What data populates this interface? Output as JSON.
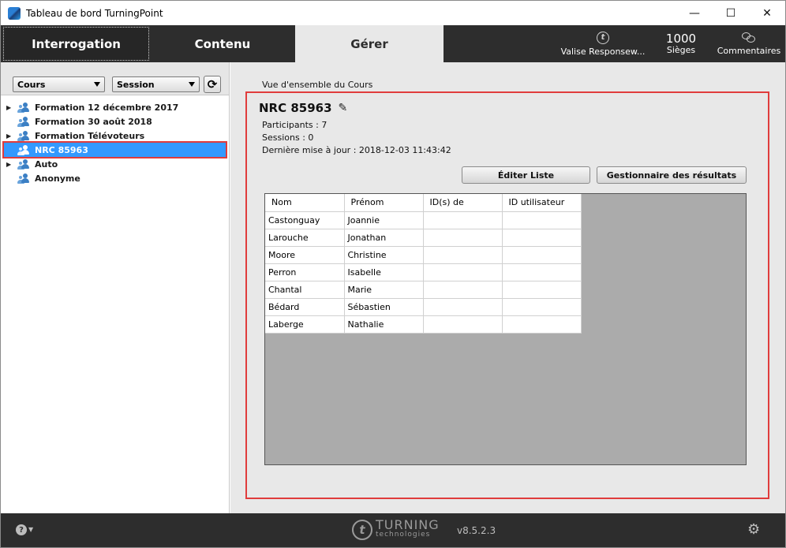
{
  "window": {
    "title": "Tableau de bord TurningPoint",
    "controls": {
      "minimize": "—",
      "maximize": "☐",
      "close": "✕"
    }
  },
  "topnav": {
    "tabs": [
      {
        "label": "Interrogation"
      },
      {
        "label": "Contenu"
      },
      {
        "label": "Gérer"
      }
    ],
    "active_tab": "Gérer",
    "valise": {
      "icon": "turning-t-icon",
      "label": "Valise Responsew..."
    },
    "sieges": {
      "count": "1000",
      "label": "Sièges"
    },
    "commentaires": {
      "icon": "comments-icon",
      "label": "Commentaires"
    }
  },
  "left": {
    "course_dropdown": "Cours",
    "session_dropdown": "Session",
    "refresh_icon": "refresh-icon",
    "tree": [
      {
        "label": "Formation 12 décembre 2017",
        "expandable": true
      },
      {
        "label": "Formation 30 août 2018",
        "expandable": false
      },
      {
        "label": "Formation Télévoteurs",
        "expandable": true
      },
      {
        "label": "NRC 85963",
        "expandable": false,
        "selected": true
      },
      {
        "label": "Auto",
        "expandable": true
      },
      {
        "label": "Anonyme",
        "expandable": false
      }
    ]
  },
  "main": {
    "section_label": "Vue d'ensemble du Cours",
    "course_title": "NRC 85963",
    "participants": "Participants : 7",
    "sessions": "Sessions : 0",
    "last_update": "Dernière mise à jour : 2018-12-03 11:43:42",
    "btn_edit": "Éditer Liste",
    "btn_results": "Gestionnaire des résultats",
    "table": {
      "headers": [
        "Nom",
        "Prénom",
        "ID(s) de",
        "ID utilisateur"
      ],
      "rows": [
        [
          "Castonguay",
          "Joannie",
          "",
          ""
        ],
        [
          "Larouche",
          "Jonathan",
          "",
          ""
        ],
        [
          "Moore",
          "Christine",
          "",
          ""
        ],
        [
          "Perron",
          "Isabelle",
          "",
          ""
        ],
        [
          "Chantal",
          "Marie",
          "",
          ""
        ],
        [
          "Bédard",
          "Sébastien",
          "",
          ""
        ],
        [
          "Laberge",
          "Nathalie",
          "",
          ""
        ]
      ]
    }
  },
  "footer": {
    "help_icon": "help-icon",
    "logo_main": "TURNING",
    "logo_sub": "technologies",
    "version": "v8.5.2.3",
    "settings_icon": "gear-icon"
  },
  "colors": {
    "nav_bg": "#2d2d2d",
    "selected_bg": "#3399ff",
    "highlight_border": "#e03c3c",
    "person_icon": "#3b7fc4"
  }
}
